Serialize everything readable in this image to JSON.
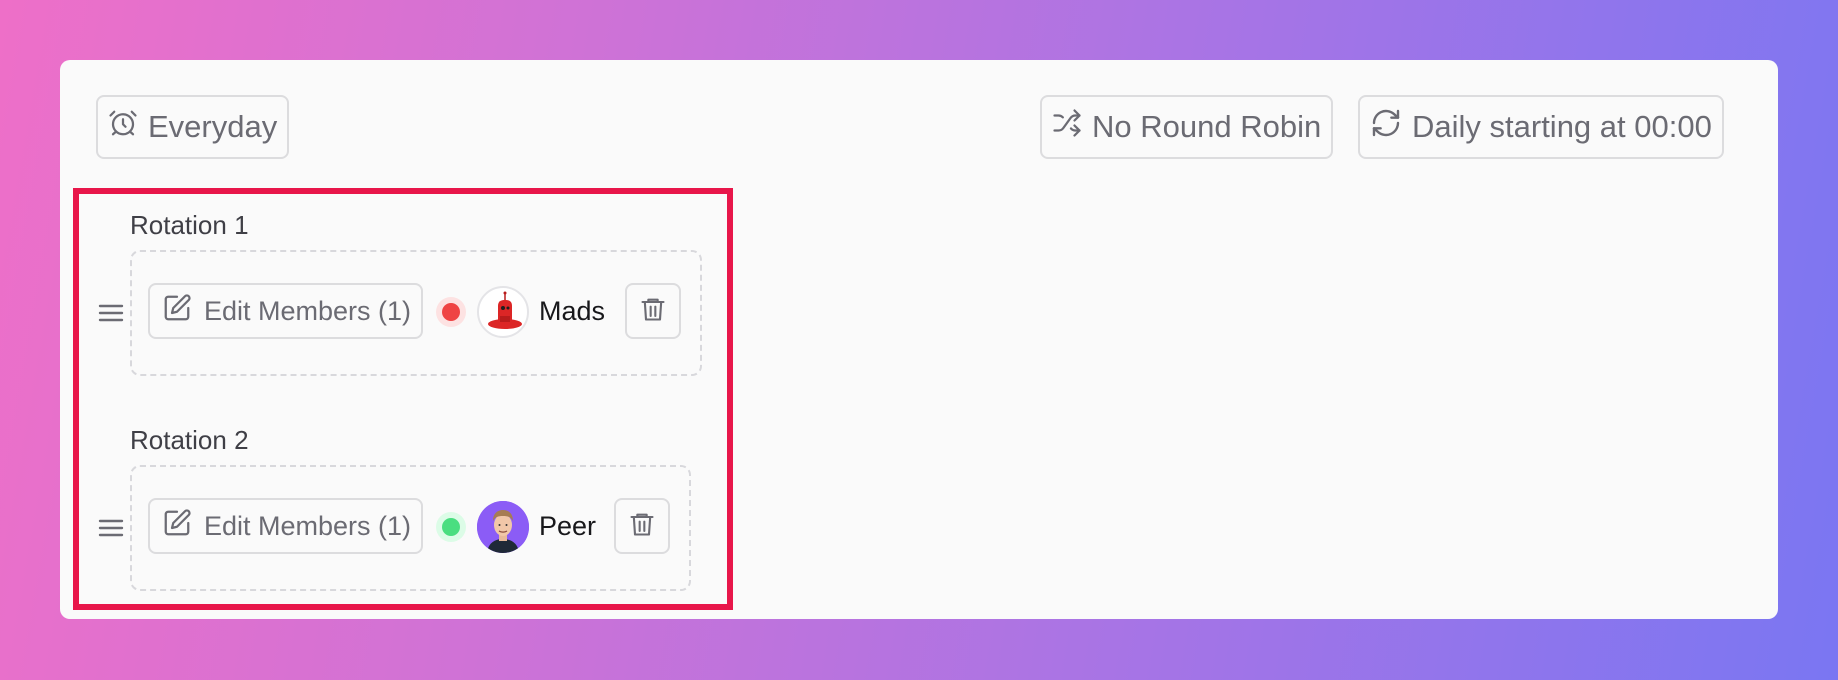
{
  "toolbar": {
    "schedule_label": "Everyday",
    "round_robin_label": "No Round Robin",
    "rotation_label": "Daily starting at 00:00"
  },
  "rotations": [
    {
      "title": "Rotation 1",
      "edit_label": "Edit Members (1)",
      "member_name": "Mads",
      "status_color": "#ef4444",
      "avatar": "red-robot-avatar"
    },
    {
      "title": "Rotation 2",
      "edit_label": "Edit Members (1)",
      "member_name": "Peer",
      "status_color": "#4ade80",
      "avatar": "person-photo-avatar"
    }
  ],
  "colors": {
    "highlight": "#e8164a",
    "card_bg": "#fafafa",
    "border": "#dcdcde"
  }
}
